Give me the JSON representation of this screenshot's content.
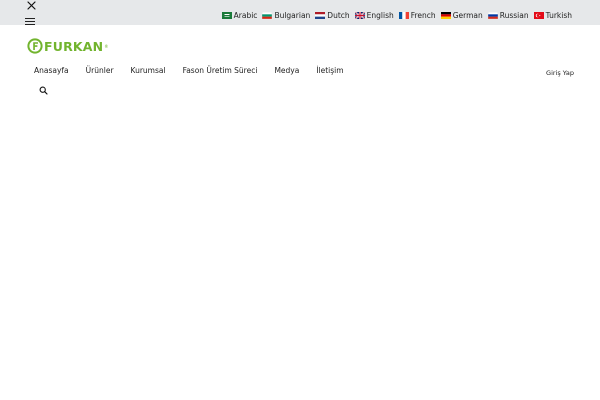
{
  "header": {
    "close_icon": "close-icon",
    "menu_icon": "hamburger-menu-icon",
    "search_icon": "search-icon"
  },
  "languages": [
    {
      "label": "Arabic",
      "flag": "flag-sa"
    },
    {
      "label": "Bulgarian",
      "flag": "flag-bg"
    },
    {
      "label": "Dutch",
      "flag": "flag-nl"
    },
    {
      "label": "English",
      "flag": "flag-gb"
    },
    {
      "label": "French",
      "flag": "flag-fr"
    },
    {
      "label": "German",
      "flag": "flag-de"
    },
    {
      "label": "Russian",
      "flag": "flag-ru"
    },
    {
      "label": "Turkish",
      "flag": "flag-tr"
    }
  ],
  "logo": {
    "text": "FURKAN",
    "mark": "®",
    "color": "#72b42e"
  },
  "nav": {
    "items": [
      "Anasayfa",
      "Ürünler",
      "Kurumsal",
      "Fason Üretim Süreci",
      "Medya",
      "İletişim"
    ]
  },
  "account": {
    "login_label": "Giriş Yap"
  },
  "colors": {
    "topbar_bg": "#e6e8ea",
    "brand": "#72b42e"
  }
}
